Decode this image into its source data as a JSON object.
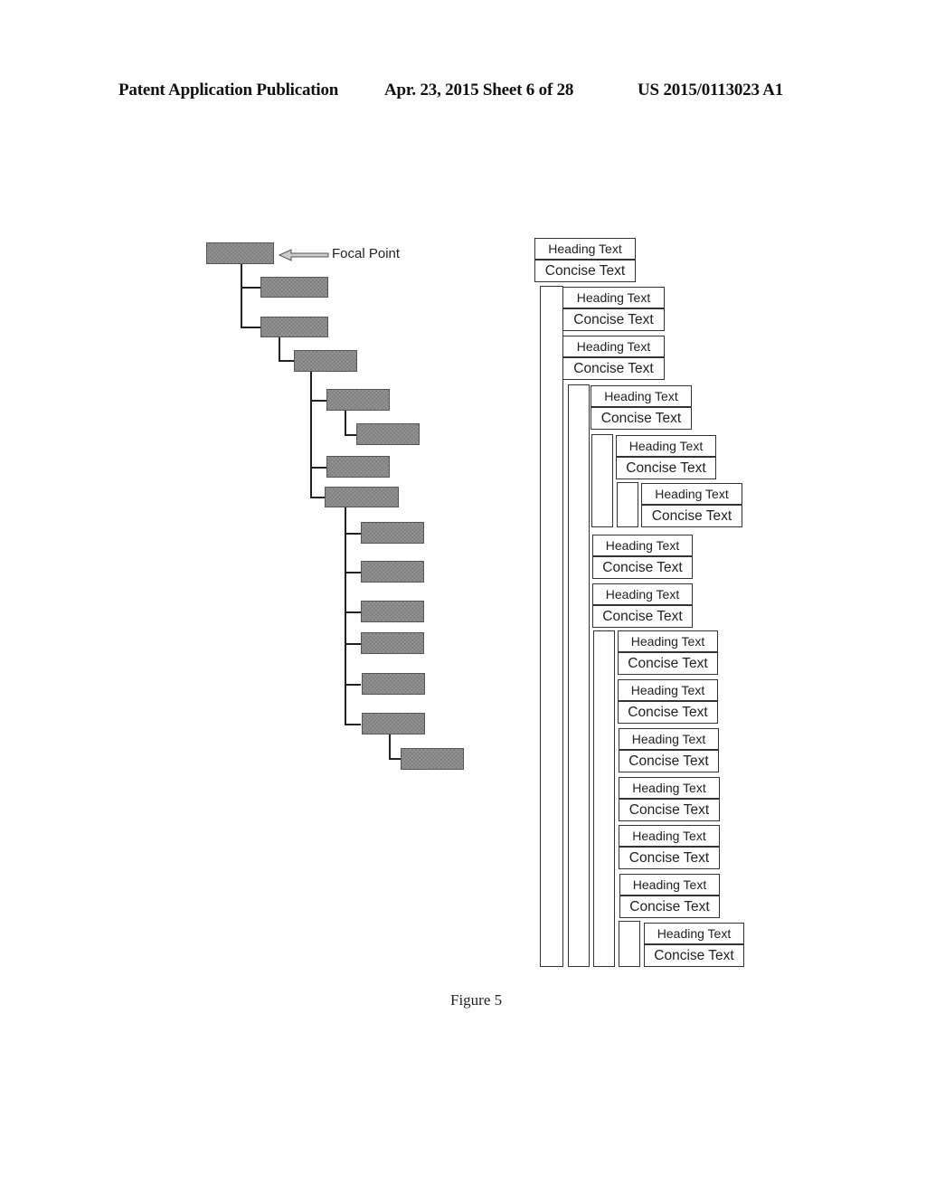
{
  "header": {
    "publication": "Patent Application Publication",
    "date_sheet": "Apr. 23, 2015  Sheet 6 of 28",
    "number": "US 2015/0113023 A1"
  },
  "tree": {
    "focal_label": "Focal Point",
    "nodes": [
      {
        "id": 0,
        "level": 0,
        "focal": true
      },
      {
        "id": 1,
        "level": 1
      },
      {
        "id": 2,
        "level": 1
      },
      {
        "id": 3,
        "level": 2
      },
      {
        "id": 4,
        "level": 3
      },
      {
        "id": 5,
        "level": 4
      },
      {
        "id": 6,
        "level": 3
      },
      {
        "id": 7,
        "level": 3
      },
      {
        "id": 8,
        "level": 4
      },
      {
        "id": 9,
        "level": 4
      },
      {
        "id": 10,
        "level": 4
      },
      {
        "id": 11,
        "level": 4
      },
      {
        "id": 12,
        "level": 4
      },
      {
        "id": 13,
        "level": 4
      },
      {
        "id": 14,
        "level": 5
      }
    ]
  },
  "cards": {
    "heading": "Heading Text",
    "concise": "Concise Text",
    "items": [
      {
        "level": 0,
        "heading": "Heading Text",
        "concise": "Concise Text"
      },
      {
        "level": 1,
        "heading": "Heading Text",
        "concise": "Concise Text"
      },
      {
        "level": 1,
        "heading": "Heading Text",
        "concise": "Concise Text"
      },
      {
        "level": 2,
        "heading": "Heading Text",
        "concise": "Concise Text"
      },
      {
        "level": 3,
        "heading": "Heading Text",
        "concise": "Concise Text"
      },
      {
        "level": 4,
        "heading": "Heading Text",
        "concise": "Concise Text"
      },
      {
        "level": 2,
        "heading": "Heading Text",
        "concise": "Concise Text"
      },
      {
        "level": 2,
        "heading": "Heading Text",
        "concise": "Concise Text"
      },
      {
        "level": 3,
        "heading": "Heading Text",
        "concise": "Concise Text"
      },
      {
        "level": 3,
        "heading": "Heading Text",
        "concise": "Concise Text"
      },
      {
        "level": 3,
        "heading": "Heading Text",
        "concise": "Concise Text"
      },
      {
        "level": 3,
        "heading": "Heading Text",
        "concise": "Concise Text"
      },
      {
        "level": 3,
        "heading": "Heading Text",
        "concise": "Concise Text"
      },
      {
        "level": 3,
        "heading": "Heading Text",
        "concise": "Concise Text"
      },
      {
        "level": 4,
        "heading": "Heading Text",
        "concise": "Concise Text"
      }
    ]
  },
  "caption": "Figure 5"
}
